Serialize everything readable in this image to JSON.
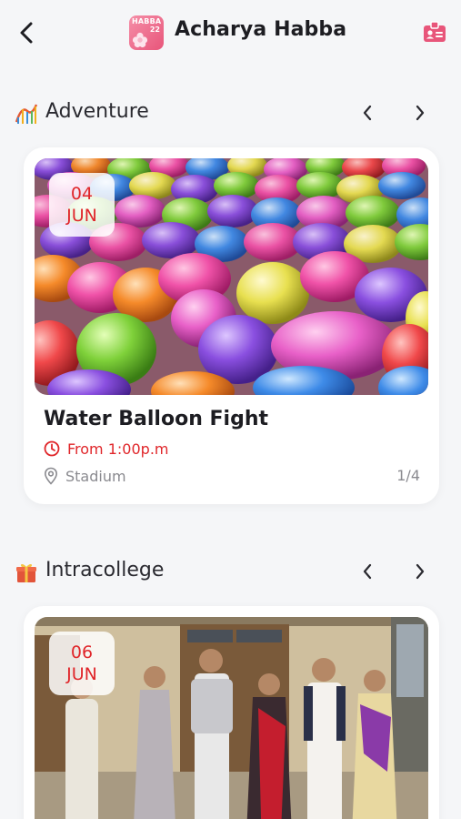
{
  "header": {
    "title": "Acharya Habba",
    "logo_text": "HABBA",
    "logo_year": "22",
    "back_icon": "chevron-left-icon",
    "id_icon": "id-badge-icon"
  },
  "sections": [
    {
      "title": "Adventure",
      "icon": "roller-coaster-icon",
      "event": {
        "day": "04",
        "month": "JUN",
        "title": "Water Balloon Fight",
        "time": "From 1:00p.m",
        "location": "Stadium",
        "pager": "1/4"
      }
    },
    {
      "title": "Intracollege",
      "icon": "gift-icon",
      "event": {
        "day": "06",
        "month": "JUN"
      }
    }
  ],
  "colors": {
    "accent_red": "#e0262a",
    "brand_pink": "#e8557a",
    "background": "#f5f6f8"
  }
}
